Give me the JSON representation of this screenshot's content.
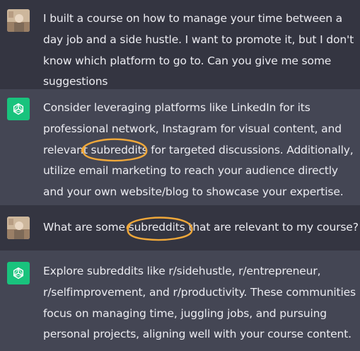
{
  "colors": {
    "user_bg": "#343541",
    "assistant_bg": "#444654",
    "text": "#ececf1",
    "bot_avatar": "#19c37d",
    "highlight_circle": "#f0a83a"
  },
  "conversation": [
    {
      "role": "user",
      "avatar_icon": "user-avatar",
      "lines": [
        "I built a course on how to manage your time between a",
        "day job and a side hustle. I want to promote it, but I don't",
        "know which platform to go to. Can you give me some",
        "suggestions"
      ]
    },
    {
      "role": "assistant",
      "avatar_icon": "openai-logo-icon",
      "lines": [
        "Consider leveraging platforms like LinkedIn for its",
        "professional network, Instagram for visual content, and",
        "relevant subreddits for targeted discussions. Additionally,",
        "utilize email marketing to reach your audience directly",
        "and your own website/blog to showcase your expertise."
      ]
    },
    {
      "role": "user",
      "avatar_icon": "user-avatar",
      "lines": [
        "What are some subreddits that are relevant to my course?"
      ]
    },
    {
      "role": "assistant",
      "avatar_icon": "openai-logo-icon",
      "lines": [
        "Explore subreddits like r/sidehustle, r/entrepreneur,",
        "r/selfimprovement, and r/productivity. These communities",
        "focus on managing time, juggling jobs, and pursuing",
        "personal projects, aligning well with your course content."
      ]
    }
  ]
}
